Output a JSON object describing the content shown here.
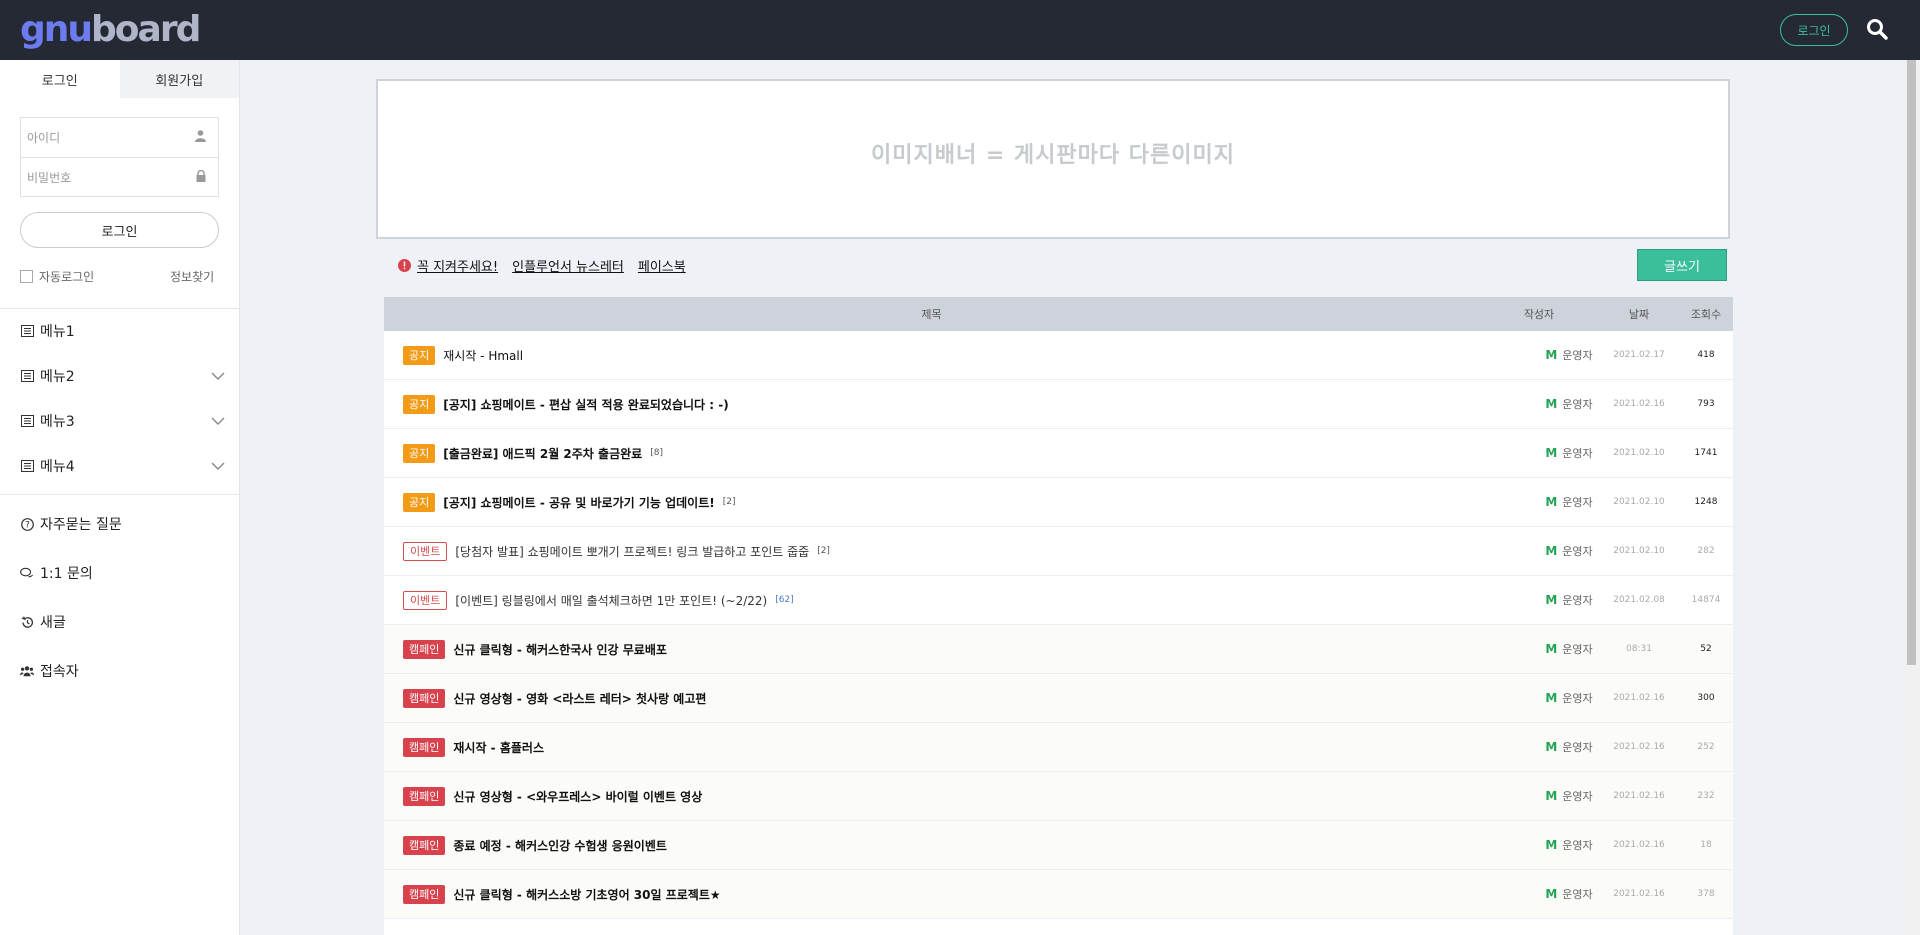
{
  "header": {
    "logo": {
      "part_a": "gnu",
      "part_b": "board"
    },
    "login_label": "로그인",
    "search_icon": "search-icon"
  },
  "sidebar": {
    "tabs": [
      {
        "label": "로그인"
      },
      {
        "label": "회원가입"
      }
    ],
    "id_placeholder": "아이디",
    "password_placeholder": "비밀번호",
    "login_button": "로그인",
    "auto_login": "자동로그인",
    "find_info": "정보찾기",
    "menus": [
      {
        "label": "메뉴1",
        "has_submenu": false
      },
      {
        "label": "메뉴2",
        "has_submenu": true
      },
      {
        "label": "메뉴3",
        "has_submenu": true
      },
      {
        "label": "메뉴4",
        "has_submenu": true
      }
    ],
    "links": [
      {
        "label": "자주묻는 질문",
        "icon": "question-circle-icon"
      },
      {
        "label": "1:1 문의",
        "icon": "chat-bubbles-icon"
      },
      {
        "label": "새글",
        "icon": "history-icon"
      },
      {
        "label": "접속자",
        "icon": "users-icon"
      }
    ]
  },
  "banner": {
    "text": "이미지배너 = 게시판마다 다른이미지"
  },
  "notice_links": [
    {
      "label": "꼭 지켜주세요!"
    },
    {
      "label": "인플루언서 뉴스레터"
    },
    {
      "label": "페이스북"
    }
  ],
  "write_button": "글쓰기",
  "board": {
    "columns": {
      "title": "제목",
      "writer": "작성자",
      "date": "날짜",
      "hits": "조회수"
    },
    "rows": [
      {
        "badge": "공지",
        "badge_type": "notice",
        "subject": "재시작 - Hmall",
        "comments": "",
        "writer": "운영자",
        "date": "2021.02.17",
        "hits": "418",
        "style": "normal"
      },
      {
        "badge": "공지",
        "badge_type": "notice",
        "subject": "[공지] 쇼핑메이트 - 편삽 실적 적용 완료되었습니다 : -)",
        "comments": "",
        "writer": "운영자",
        "date": "2021.02.16",
        "hits": "793",
        "style": "bold"
      },
      {
        "badge": "공지",
        "badge_type": "notice",
        "subject": "[출금완료] 애드픽 2월 2주차 출금완료",
        "comments": "[8]",
        "writer": "운영자",
        "date": "2021.02.10",
        "hits": "1741",
        "style": "bold"
      },
      {
        "badge": "공지",
        "badge_type": "notice",
        "subject": "[공지] 쇼핑메이트 - 공유 및 바로가기 기능 업데이트!",
        "comments": "[2]",
        "writer": "운영자",
        "date": "2021.02.10",
        "hits": "1248",
        "style": "bold"
      },
      {
        "badge": "이벤트",
        "badge_type": "event",
        "subject": "[당첨자 발표] 쇼핑메이트 뽀개기 프로젝트! 링크 발급하고 포인트 줍줍",
        "comments": "[2]",
        "writer": "운영자",
        "date": "2021.02.10",
        "hits": "282",
        "style": "muted"
      },
      {
        "badge": "이벤트",
        "badge_type": "event",
        "subject": "[이벤트] 링블링에서 매일 출석체크하면 1만 포인트! (~2/22)",
        "comments": "[62]",
        "writer": "운영자",
        "date": "2021.02.08",
        "hits": "14874",
        "style": "muted"
      },
      {
        "badge": "캠페인",
        "badge_type": "campaign",
        "subject": "신규 클릭형 - 해커스한국사 인강 무료배포",
        "comments": "",
        "writer": "운영자",
        "date": "08:31",
        "hits": "52",
        "style": "bold"
      },
      {
        "badge": "캠페인",
        "badge_type": "campaign",
        "subject": "신규 영상형 - 영화 <라스트 레터> 첫사랑 예고편",
        "comments": "",
        "writer": "운영자",
        "date": "2021.02.16",
        "hits": "300",
        "style": "bold"
      },
      {
        "badge": "캠페인",
        "badge_type": "campaign",
        "subject": "재시작 - 홈플러스",
        "comments": "",
        "writer": "운영자",
        "date": "2021.02.16",
        "hits": "252",
        "style": "bold"
      },
      {
        "badge": "캠페인",
        "badge_type": "campaign",
        "subject": "신규 영상형 - <와우프레스> 바이럴 이벤트 영상",
        "comments": "",
        "writer": "운영자",
        "date": "2021.02.16",
        "hits": "232",
        "style": "bold"
      },
      {
        "badge": "캠페인",
        "badge_type": "campaign",
        "subject": "종료 예정 - 해커스인강 수험생 응원이벤트",
        "comments": "",
        "writer": "운영자",
        "date": "2021.02.16",
        "hits": "18",
        "style": "bold"
      },
      {
        "badge": "캠페인",
        "badge_type": "campaign",
        "subject": "신규 클릭형 - 해커스소방 기초영어 30일 프로젝트★",
        "comments": "",
        "writer": "운영자",
        "date": "2021.02.16",
        "hits": "378",
        "style": "bold"
      }
    ]
  },
  "colors": {
    "accent": "#3bbf9a",
    "topbar": "#252934",
    "notice_badge": "#f39a17",
    "campaign_badge": "#d8424d"
  }
}
